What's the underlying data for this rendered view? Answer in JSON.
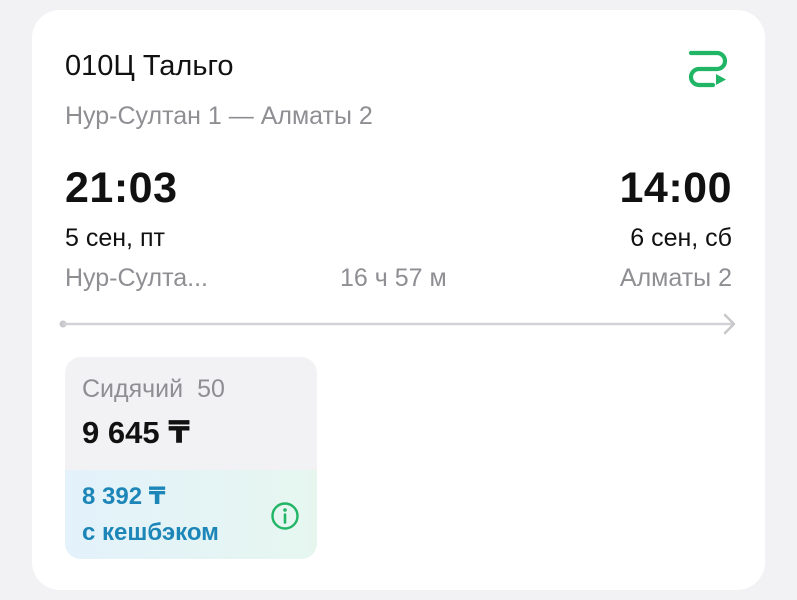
{
  "train": {
    "name": "010Ц Тальго",
    "route": "Нур-Султан 1 — Алматы 2",
    "route_icon": "route-icon"
  },
  "departure": {
    "time": "21:03",
    "date": "5 сен, пт",
    "station": "Нур-Султа..."
  },
  "arrival": {
    "time": "14:00",
    "date": "6 сен, сб",
    "station": "Алматы 2"
  },
  "duration": "16 ч 57 м",
  "fare": {
    "class": "Сидячий",
    "seats": "50",
    "price": "9 645 ₸",
    "cashback_price": "8 392 ₸",
    "cashback_label": "с кешбэком",
    "info_icon": "info-icon"
  },
  "colors": {
    "accent_green": "#21b566",
    "cashback_blue": "#1d86b8",
    "muted_text": "#8e8e93"
  }
}
